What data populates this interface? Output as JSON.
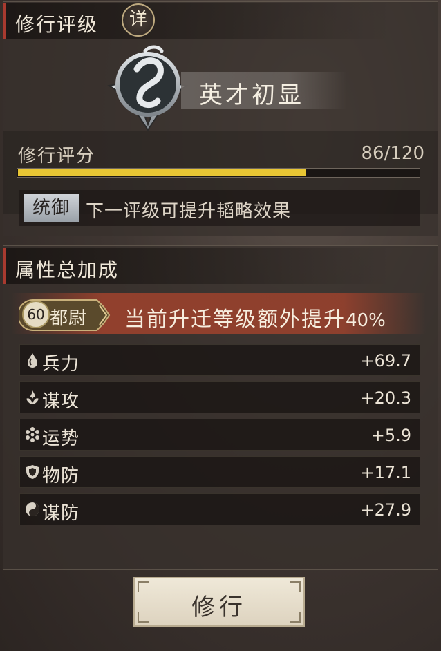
{
  "rating_panel": {
    "title": "修行评级",
    "detail_label": "详",
    "rank_name": "英才初显",
    "score_label": "修行评分",
    "score_text": "86/120",
    "score_fraction": 0.7167,
    "hint_tag": "统御",
    "hint_text": "下一评级可提升韬略效果"
  },
  "bonus_panel": {
    "title": "属性总加成",
    "level_number": "60",
    "level_title": "都尉",
    "bonus_text": "当前升迁等级额外提升",
    "bonus_percent": "40%",
    "attributes": [
      {
        "icon": "drop-icon",
        "name": "兵力",
        "value": "+69.7"
      },
      {
        "icon": "flame-icon",
        "name": "谋攻",
        "value": "+20.3"
      },
      {
        "icon": "ring-dots-icon",
        "name": "运势",
        "value": "+5.9"
      },
      {
        "icon": "shield-icon",
        "name": "物防",
        "value": "+17.1"
      },
      {
        "icon": "yin-yang-icon",
        "name": "谋防",
        "value": "+27.9"
      }
    ]
  },
  "actions": {
    "cultivate_label": "修行"
  },
  "colors": {
    "accent_red": "#a83a2f",
    "progress_yellow": "#e8c634",
    "banner_red": "#96412d"
  }
}
